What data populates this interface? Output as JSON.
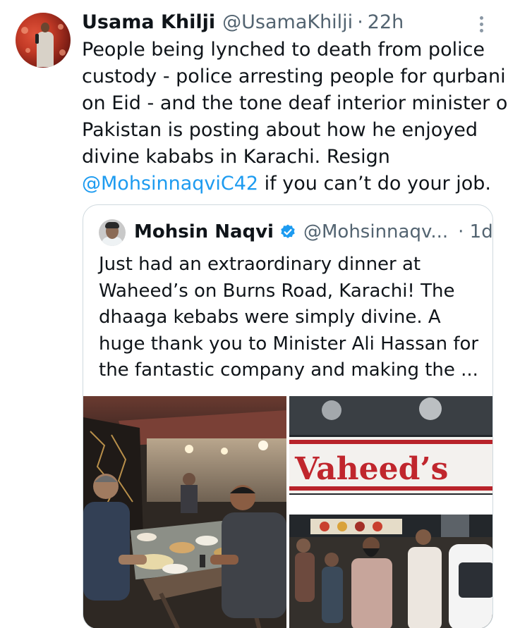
{
  "tweet": {
    "author_name": "Usama Khilji",
    "handle": "@UsamaKhilji",
    "separator": "·",
    "timestamp": "22h",
    "lines": [
      "People being lynched to death from police",
      "custody - police arresting people for qurbani",
      "on Eid - and the tone deaf interior minister of",
      "Pakistan is posting about how he enjoyed",
      "divine kababs in Karachi. Resign"
    ],
    "mention": "@MohsinnaqviC42",
    "last_line_rest": " if you can’t do your job."
  },
  "quote": {
    "author_name": "Mohsin Naqvi",
    "handle": "@Mohsinnaqv...",
    "timestamp": "· 1d",
    "verified": true,
    "lines": [
      "Just had an extraordinary dinner at",
      "Waheed’s on Burns Road, Karachi! The",
      "dhaaga kebabs were simply divine. A",
      "huge thank you to Minister Ali Hassan for",
      "the fantastic company and making the ..."
    ],
    "media_sign_text": "Vaheed’s"
  },
  "icons": {
    "more": "more-vertical-icon",
    "verified": "verified-badge-icon"
  },
  "colors": {
    "link": "#1d9bf0",
    "secondary_text": "#536471",
    "border": "#cfd9de"
  }
}
